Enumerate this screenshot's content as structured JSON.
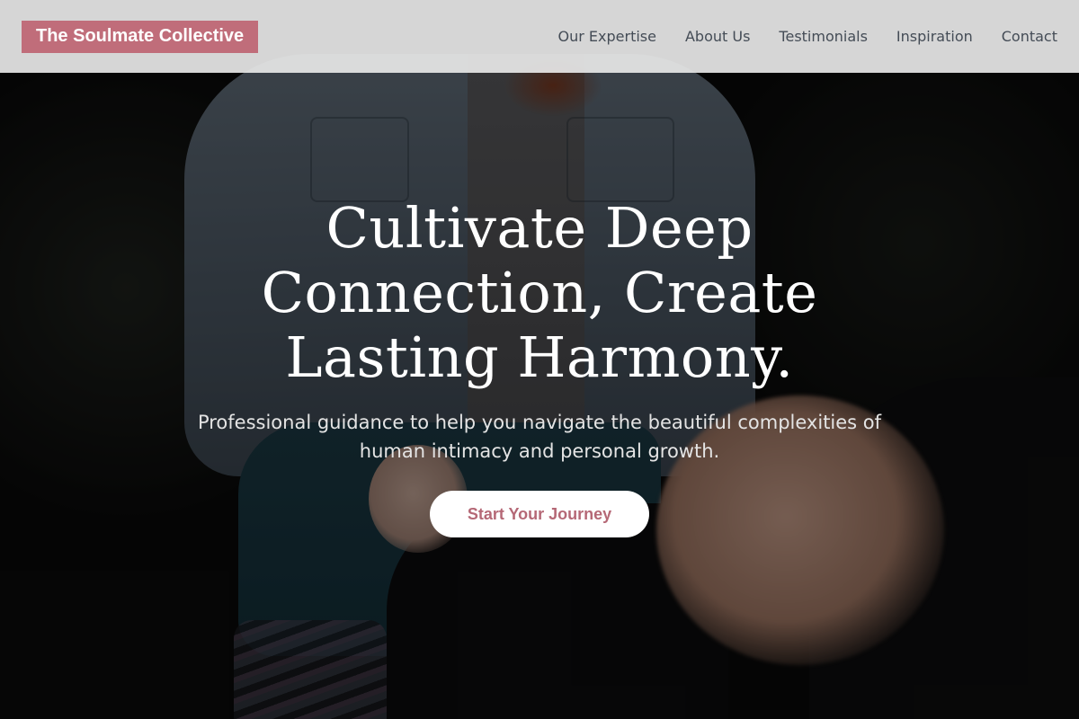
{
  "colors": {
    "brand": "#c06d7a",
    "cta_text": "#b56876",
    "header_bg": "#e8e8e8",
    "nav_text": "#444c56"
  },
  "header": {
    "logo": "The Soulmate Collective",
    "nav": [
      {
        "label": "Our Expertise"
      },
      {
        "label": "About Us"
      },
      {
        "label": "Testimonials"
      },
      {
        "label": "Inspiration"
      },
      {
        "label": "Contact"
      }
    ]
  },
  "hero": {
    "title": "Cultivate Deep Connection, Create Lasting Harmony.",
    "subtitle": "Professional guidance to help you navigate the beautiful complexities of human intimacy and personal growth.",
    "cta_label": "Start Your Journey",
    "background_image": "two-people-holding-hands-photo"
  }
}
